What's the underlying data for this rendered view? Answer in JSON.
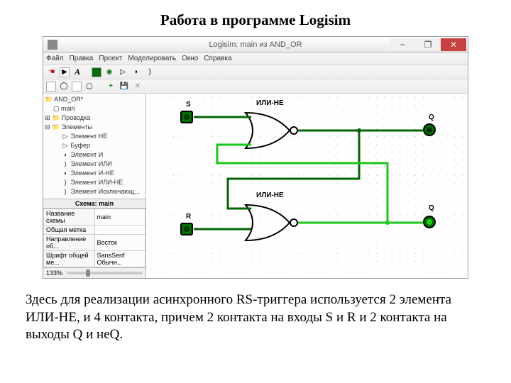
{
  "page": {
    "title": "Работа в программе Logisim",
    "caption": "Здесь для реализации асинхронного RS-триггера используется 2 элемента ИЛИ-НЕ, и 4 контакта, причем 2 контакта на входы S и R и 2 контакта на выходы Q и неQ."
  },
  "window": {
    "title": "Logisim: main из AND_OR",
    "controls": {
      "min": "−",
      "max": "❐",
      "close": "✕"
    }
  },
  "menu": [
    "Файл",
    "Правка",
    "Проект",
    "Моделировать",
    "Окно",
    "Справка"
  ],
  "tree": {
    "project": "AND_OR*",
    "main": "main",
    "wiring": "Проводка",
    "elements_group": "Элементы",
    "items": [
      "Элемент НЕ",
      "Буфер",
      "Элемент И",
      "Элемент ИЛИ",
      "Элемент И-НЕ",
      "Элемент ИЛИ-НЕ",
      "Элемент Исключающ..."
    ]
  },
  "props": {
    "header": "Схема: main",
    "rows": [
      {
        "k": "Название схемы",
        "v": "main"
      },
      {
        "k": "Общая метка",
        "v": ""
      },
      {
        "k": "Направление об...",
        "v": "Восток"
      },
      {
        "k": "Шрифт общей ме...",
        "v": "SansSerif Обычн..."
      }
    ]
  },
  "zoom": "133%",
  "canvas": {
    "gate1_label": "ИЛИ-НЕ",
    "gate2_label": "ИЛИ-НЕ",
    "pin_s": "S",
    "pin_r": "R",
    "pin_q": "Q",
    "pin_nq_bar": "_",
    "pin_nq": "Q"
  }
}
